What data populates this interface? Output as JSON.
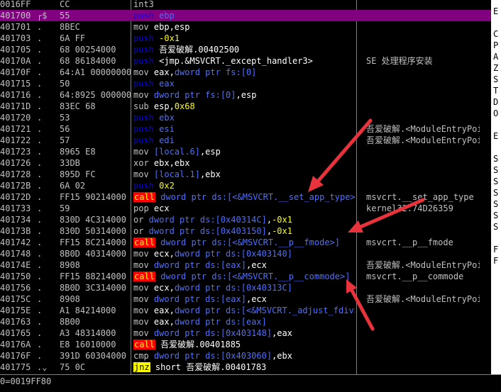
{
  "rows": [
    {
      "addr": "0016FF",
      "mark": "",
      "hex": "CC",
      "mn": "",
      "ops": [
        {
          "t": "int3",
          "c": "gray"
        }
      ],
      "cmt": ""
    },
    {
      "addr": "401700",
      "mark": "┌$",
      "hex": "55",
      "mn": "push",
      "ops": [
        {
          "t": " ebp",
          "c": "blue"
        }
      ],
      "cmt": "",
      "sel": true
    },
    {
      "addr": "401701",
      "mark": ".",
      "hex": "8BEC",
      "mn": "mov",
      "ops": [
        {
          "t": " ebp,esp",
          "c": "white"
        }
      ],
      "cmt": ""
    },
    {
      "addr": "401703",
      "mark": ".",
      "hex": "6A FF",
      "mn": "push",
      "ops": [
        {
          "t": " -0x1",
          "c": "yellow"
        }
      ],
      "cmt": ""
    },
    {
      "addr": "401705",
      "mark": ".",
      "hex": "68 00254000",
      "mn": "push",
      "ops": [
        {
          "t": " 吾爱破解.00402500",
          "c": "white"
        }
      ],
      "cmt": ""
    },
    {
      "addr": "40170A",
      "mark": ".",
      "hex": "68 86184000",
      "mn": "push",
      "ops": [
        {
          "t": " <jmp.&MSVCRT._except_handler3>",
          "c": "white"
        }
      ],
      "cmt": "SE 处理程序安装"
    },
    {
      "addr": "40170F",
      "mark": ".",
      "hex": "64:A1 00000000",
      "mn": "mov",
      "ops": [
        {
          "t": " eax,",
          "c": "white"
        },
        {
          "t": "dword ptr fs:[0]",
          "c": "blue"
        }
      ],
      "cmt": ""
    },
    {
      "addr": "401715",
      "mark": ".",
      "hex": "50",
      "mn": "push",
      "ops": [
        {
          "t": " eax",
          "c": "blue"
        }
      ],
      "cmt": ""
    },
    {
      "addr": "401716",
      "mark": ".",
      "hex": "64:8925 00000000",
      "mn": "mov",
      "ops": [
        {
          "t": " dword ptr fs:[0]",
          "c": "blue"
        },
        {
          "t": ",esp",
          "c": "white"
        }
      ],
      "cmt": ""
    },
    {
      "addr": "40171D",
      "mark": ".",
      "hex": "83EC 68",
      "mn": "sub",
      "ops": [
        {
          "t": " esp,",
          "c": "white"
        },
        {
          "t": "0x68",
          "c": "yellow"
        }
      ],
      "cmt": ""
    },
    {
      "addr": "401720",
      "mark": ".",
      "hex": "53",
      "mn": "push",
      "ops": [
        {
          "t": " ebx",
          "c": "blue"
        }
      ],
      "cmt": ""
    },
    {
      "addr": "401721",
      "mark": ".",
      "hex": "56",
      "mn": "push",
      "ops": [
        {
          "t": " esi",
          "c": "blue"
        }
      ],
      "cmt": "吾爱破解.<ModuleEntryPoint>"
    },
    {
      "addr": "401722",
      "mark": ".",
      "hex": "57",
      "mn": "push",
      "ops": [
        {
          "t": " edi",
          "c": "blue"
        }
      ],
      "cmt": "吾爱破解.<ModuleEntryPoint>"
    },
    {
      "addr": "401723",
      "mark": ".",
      "hex": "8965 E8",
      "mn": "mov",
      "ops": [
        {
          "t": " [local.6]",
          "c": "blue"
        },
        {
          "t": ",esp",
          "c": "white"
        }
      ],
      "cmt": ""
    },
    {
      "addr": "401726",
      "mark": ".",
      "hex": "33DB",
      "mn": "xor",
      "ops": [
        {
          "t": " ebx,ebx",
          "c": "white"
        }
      ],
      "cmt": ""
    },
    {
      "addr": "401728",
      "mark": ".",
      "hex": "895D FC",
      "mn": "mov",
      "ops": [
        {
          "t": " [local.1]",
          "c": "blue"
        },
        {
          "t": ",ebx",
          "c": "white"
        }
      ],
      "cmt": ""
    },
    {
      "addr": "40172B",
      "mark": ".",
      "hex": "6A 02",
      "mn": "push",
      "ops": [
        {
          "t": " 0x2",
          "c": "yellow"
        }
      ],
      "cmt": ""
    },
    {
      "addr": "40172D",
      "mark": ".",
      "hex": "FF15 90214000",
      "mn": "call",
      "ops": [
        {
          "t": " dword ptr ds:[<&MSVCRT.__set_app_type>]",
          "c": "blue"
        }
      ],
      "cmt": "msvcrt.__set_app_type"
    },
    {
      "addr": "401733",
      "mark": ".",
      "hex": "59",
      "mn": "pop",
      "ops": [
        {
          "t": " ecx",
          "c": "white"
        }
      ],
      "cmt": "kernel32.74D26359"
    },
    {
      "addr": "401734",
      "mark": ".",
      "hex": "830D 4C314000",
      "mn": "or",
      "ops": [
        {
          "t": " dword ptr ds:[0x40314C]",
          "c": "blue"
        },
        {
          "t": ",",
          "c": "white"
        },
        {
          "t": "-0x1",
          "c": "yellow"
        }
      ],
      "cmt": ""
    },
    {
      "addr": "40173B",
      "mark": ".",
      "hex": "830D 50314000",
      "mn": "or",
      "ops": [
        {
          "t": " dword ptr ds:[0x403150]",
          "c": "blue"
        },
        {
          "t": ",",
          "c": "white"
        },
        {
          "t": "-0x1",
          "c": "yellow"
        }
      ],
      "cmt": ""
    },
    {
      "addr": "401742",
      "mark": ".",
      "hex": "FF15 8C214000",
      "mn": "call",
      "ops": [
        {
          "t": " dword ptr ds:[<&MSVCRT.__p__fmode>]",
          "c": "blue"
        }
      ],
      "cmt": "msvcrt.__p__fmode"
    },
    {
      "addr": "401748",
      "mark": ".",
      "hex": "8B0D 40314000",
      "mn": "mov",
      "ops": [
        {
          "t": " ecx,",
          "c": "white"
        },
        {
          "t": "dword ptr ds:[0x403140]",
          "c": "blue"
        }
      ],
      "cmt": ""
    },
    {
      "addr": "40174E",
      "mark": ".",
      "hex": "8908",
      "mn": "mov",
      "ops": [
        {
          "t": " dword ptr ds:[eax]",
          "c": "blue"
        },
        {
          "t": ",ecx",
          "c": "white"
        }
      ],
      "cmt": "吾爱破解.<ModuleEntryPoint>"
    },
    {
      "addr": "401750",
      "mark": ".",
      "hex": "FF15 88214000",
      "mn": "call",
      "ops": [
        {
          "t": " dword ptr ds:[<&MSVCRT.__p__commode>]",
          "c": "blue"
        }
      ],
      "cmt": "msvcrt.__p__commode"
    },
    {
      "addr": "401756",
      "mark": ".",
      "hex": "8B0D 3C314000",
      "mn": "mov",
      "ops": [
        {
          "t": " ecx,",
          "c": "white"
        },
        {
          "t": "dword ptr ds:[0x40313C]",
          "c": "blue"
        }
      ],
      "cmt": ""
    },
    {
      "addr": "40175C",
      "mark": ".",
      "hex": "8908",
      "mn": "mov",
      "ops": [
        {
          "t": " dword ptr ds:[eax]",
          "c": "blue"
        },
        {
          "t": ",ecx",
          "c": "white"
        }
      ],
      "cmt": "吾爱破解.<ModuleEntryPoint>"
    },
    {
      "addr": "40175E",
      "mark": ".",
      "hex": "A1 84214000",
      "mn": "mov",
      "ops": [
        {
          "t": " eax,",
          "c": "white"
        },
        {
          "t": "dword ptr ds:[<&MSVCRT._adjust_fdiv>]",
          "c": "blue"
        }
      ],
      "cmt": ""
    },
    {
      "addr": "401763",
      "mark": ".",
      "hex": "8B00",
      "mn": "mov",
      "ops": [
        {
          "t": " eax,",
          "c": "white"
        },
        {
          "t": "dword ptr ds:[eax]",
          "c": "blue"
        }
      ],
      "cmt": ""
    },
    {
      "addr": "401765",
      "mark": ".",
      "hex": "A3 48314000",
      "mn": "mov",
      "ops": [
        {
          "t": " dword ptr ds:[0x403148]",
          "c": "blue"
        },
        {
          "t": ",eax",
          "c": "white"
        }
      ],
      "cmt": ""
    },
    {
      "addr": "40176A",
      "mark": ".",
      "hex": "E8 16010000",
      "mn": "call",
      "ops": [
        {
          "t": " 吾爱破解.00401885",
          "c": "white"
        }
      ],
      "cmt": ""
    },
    {
      "addr": "40176F",
      "mark": ".",
      "hex": "391D 60304000",
      "mn": "cmp",
      "ops": [
        {
          "t": " dword ptr ds:[0x403060]",
          "c": "blue"
        },
        {
          "t": ",ebx",
          "c": "white"
        }
      ],
      "cmt": ""
    },
    {
      "addr": "401775",
      "mark": ".⌄",
      "hex": "75 0C",
      "mn": "jnz",
      "ops": [
        {
          "t": " short 吾爱破解.00401783",
          "c": "white"
        }
      ],
      "cmt": ""
    }
  ],
  "registers_fragment": [
    "E",
    "",
    "C",
    "P",
    "A",
    "Z",
    "S",
    "T",
    "D",
    "O",
    "",
    "E",
    "",
    "S",
    "S",
    "S",
    "S",
    "S",
    "S",
    "S",
    "",
    "F",
    "F"
  ],
  "status_text": "0=0019FF80"
}
